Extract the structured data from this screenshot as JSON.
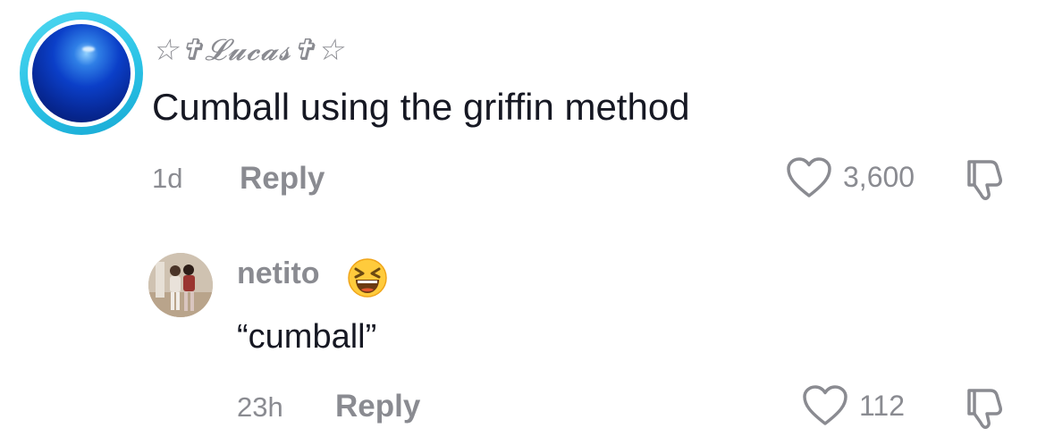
{
  "comments": [
    {
      "username": "☆✞𝓛𝓾𝓬𝓪𝓼✞☆",
      "text": "Cumball using the griffin method",
      "time": "1d",
      "reply_label": "Reply",
      "likes": "3,600"
    },
    {
      "username": "netito",
      "text": "“cumball”",
      "time": "23h",
      "reply_label": "Reply",
      "likes": "112"
    }
  ],
  "icons": {
    "like": "heart-outline-icon",
    "dislike": "thumbs-down-icon",
    "emoji": "grinning-squinting-face-emoji"
  },
  "colors": {
    "text": "#161823",
    "muted": "#8a8b91",
    "avatar_ring": "#2bc3e6"
  }
}
